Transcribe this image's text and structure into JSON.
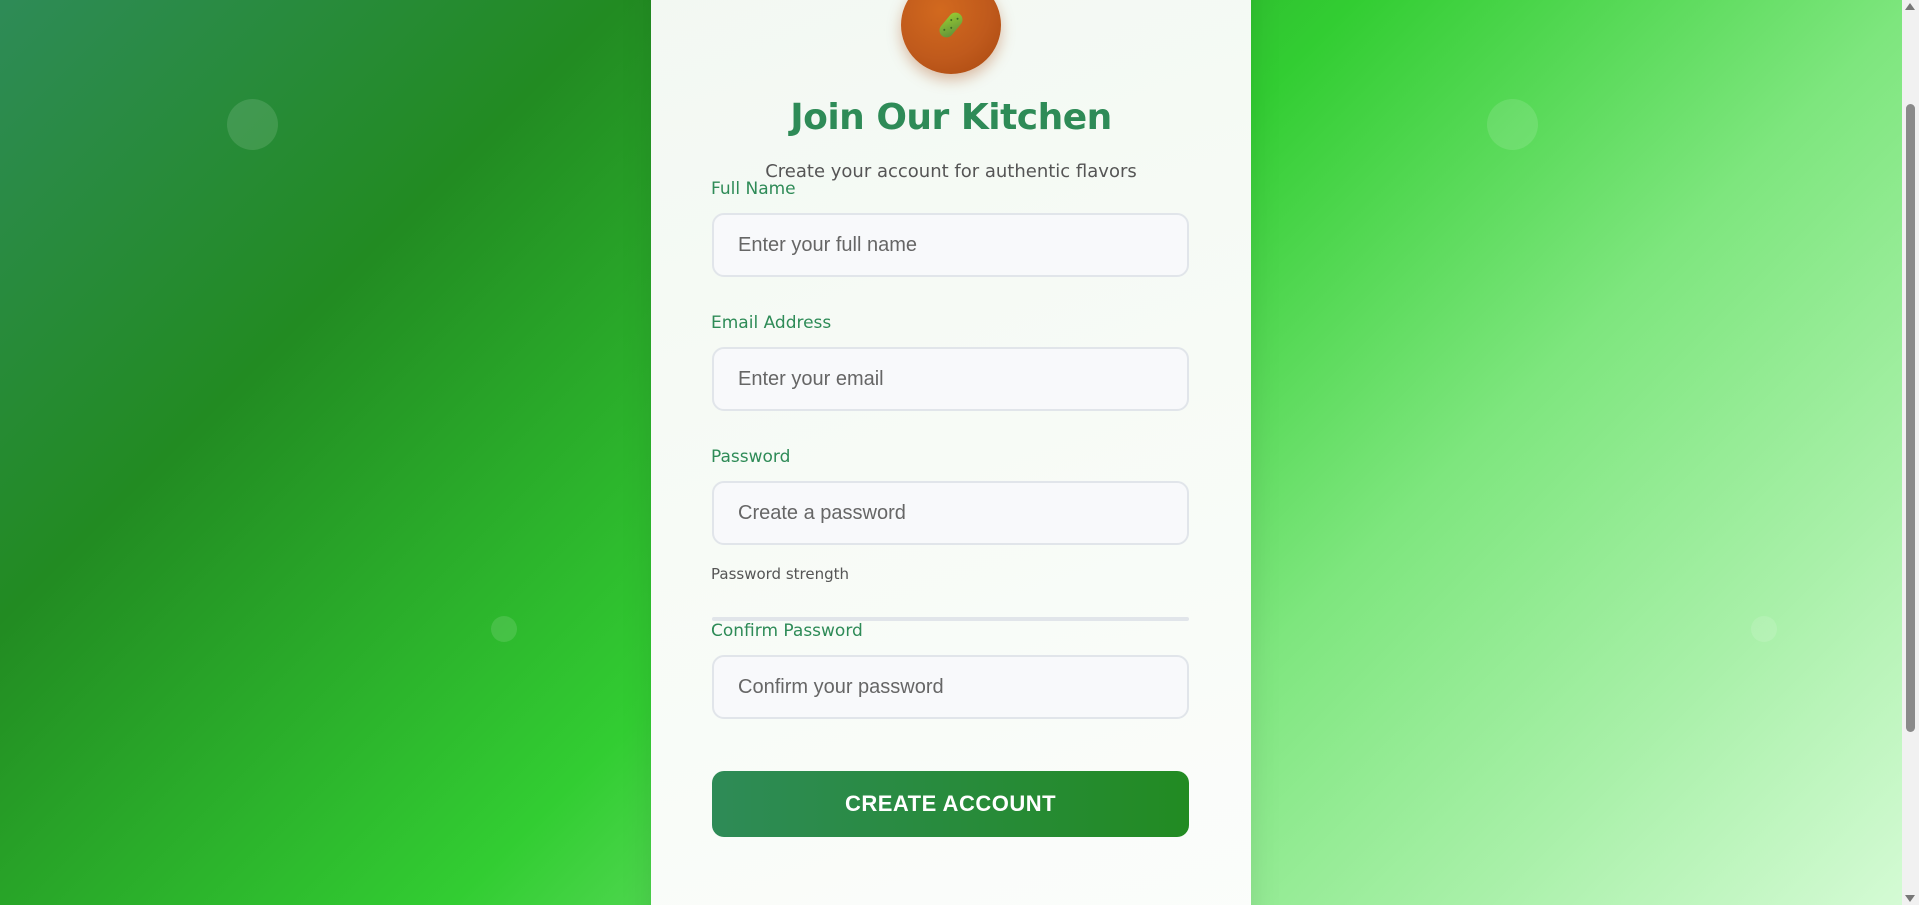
{
  "header": {
    "logo_icon": "cucumber-icon",
    "title": "Join Our Kitchen",
    "subtitle": "Create your account for authentic flavors"
  },
  "form": {
    "full_name": {
      "label": "Full Name",
      "placeholder": "Enter your full name",
      "value": ""
    },
    "email": {
      "label": "Email Address",
      "placeholder": "Enter your email",
      "value": ""
    },
    "password": {
      "label": "Password",
      "placeholder": "Create a password",
      "value": ""
    },
    "password_strength": {
      "label": "Password strength",
      "level": 0
    },
    "confirm_password": {
      "label": "Confirm Password",
      "placeholder": "Confirm your password",
      "value": ""
    },
    "submit_label": "CREATE ACCOUNT"
  },
  "colors": {
    "primary": "#2e8b57",
    "accent": "#32cd32",
    "logo": "#d2691e"
  }
}
